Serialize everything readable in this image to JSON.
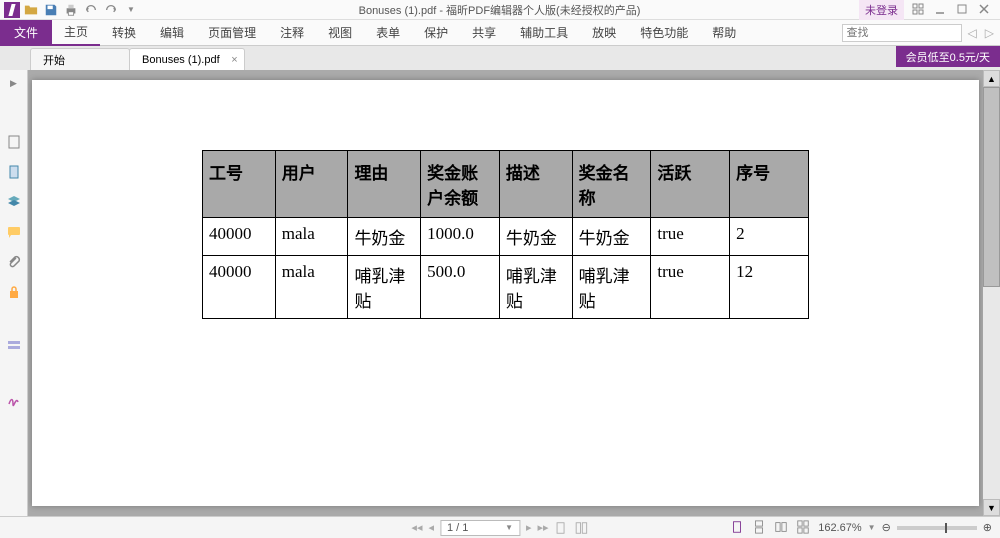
{
  "titlebar": {
    "title": "Bonuses (1).pdf - 福昕PDF编辑器个人版(未经授权的产品)",
    "login": "未登录"
  },
  "ribbon": {
    "file": "文件",
    "tabs": [
      "主页",
      "转换",
      "编辑",
      "页面管理",
      "注释",
      "视图",
      "表单",
      "保护",
      "共享",
      "辅助工具",
      "放映",
      "特色功能",
      "帮助"
    ],
    "search_placeholder": "查找",
    "promo": "会员低至0.5元/天"
  },
  "doc_tabs": [
    {
      "label": "开始"
    },
    {
      "label": "Bonuses (1).pdf"
    }
  ],
  "table": {
    "headers": [
      "工号",
      "用户",
      "理由",
      "奖金账户余额",
      "描述",
      "奖金名称",
      "活跃",
      "序号"
    ],
    "rows": [
      [
        "40000",
        "mala",
        "牛奶金",
        "1000.0",
        "牛奶金",
        "牛奶金",
        "true",
        "2"
      ],
      [
        "40000",
        "mala",
        "哺乳津贴",
        "500.0",
        "哺乳津贴",
        "哺乳津贴",
        "true",
        "12"
      ]
    ]
  },
  "statusbar": {
    "page": "1 / 1",
    "zoom": "162.67%"
  }
}
